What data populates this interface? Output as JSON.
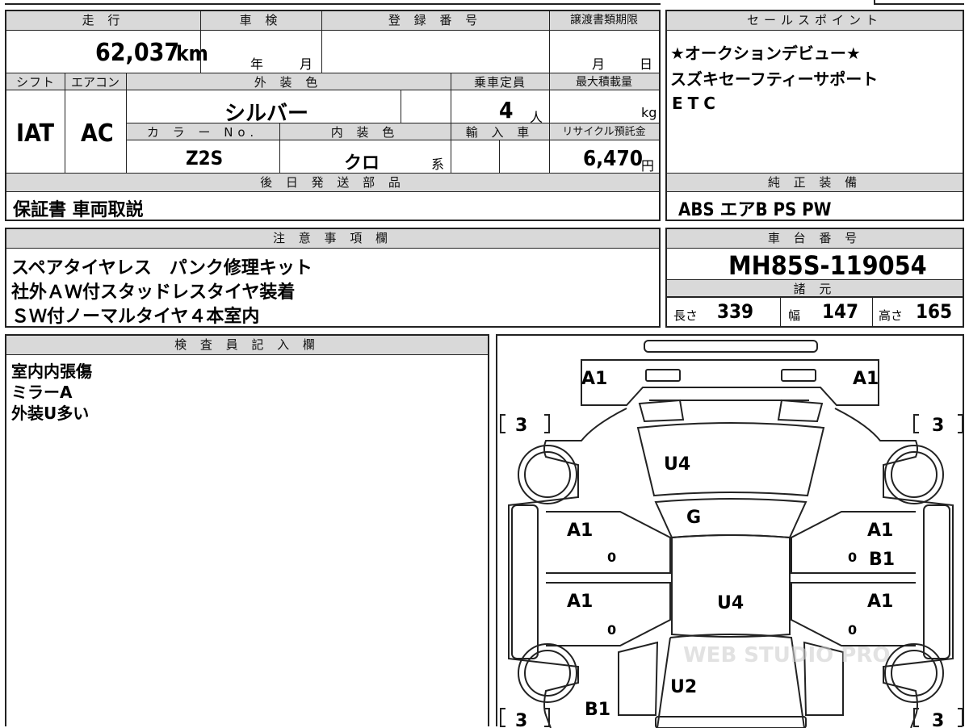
{
  "vehicle": {
    "mileage_label": "走 行",
    "mileage_value": "62,037",
    "mileage_unit": "km",
    "shaken_label": "車 検",
    "shaken_year_unit": "年",
    "shaken_month_unit": "月",
    "registration_label": "登 録 番 号",
    "transfer_label": "譲渡書類期限",
    "transfer_month_unit": "月",
    "transfer_day_unit": "日",
    "shift_label": "シフト",
    "shift_value": "IAT",
    "aircon_label": "エアコン",
    "aircon_value": "AC",
    "exterior_color_label": "外 装 色",
    "exterior_color_value": "シルバー",
    "capacity_label": "乗車定員",
    "capacity_value": "4",
    "capacity_unit": "人",
    "max_load_label": "最大積載量",
    "max_load_unit": "kg",
    "color_no_label": "カ ラ ー No.",
    "color_no_value": "Z2S",
    "interior_color_label": "内 装 色",
    "interior_color_value": "クロ",
    "interior_color_unit": "系",
    "import_label": "輸 入 車",
    "recycle_label": "リサイクル預託金",
    "recycle_value": "6,470",
    "recycle_unit": "円",
    "later_parts_label": "後 日 発 送 部 品",
    "later_parts_value": "保証書 車両取説"
  },
  "sales_points": {
    "label": "セールスポイント",
    "lines": [
      "★オークションデビュー★",
      "スズキセーフティーサポート",
      "ETC"
    ]
  },
  "genuine_equipment": {
    "label": "純 正 装 備",
    "value": "ABS エアB PS PW"
  },
  "notes": {
    "label": "注 意 事 項 欄",
    "lines": [
      "スペアタイヤレス　パンク修理キット",
      "社外ＡＷ付スタッドレスタイヤ装着",
      "ＳＷ付ノーマルタイヤ４本室内"
    ]
  },
  "chassis": {
    "label": "車 台 番 号",
    "value": "MH85S-119054",
    "specs_label": "諸 元",
    "length_label": "長さ",
    "length_value": "339",
    "width_label": "幅",
    "width_value": "147",
    "height_label": "高さ",
    "height_value": "165"
  },
  "inspector": {
    "label": "検 査 員 記 入 欄",
    "lines": [
      "室内内張傷",
      "ミラーA",
      "外装U多い"
    ]
  },
  "diagram": {
    "marks": {
      "front_left": "A1",
      "front_right": "A1",
      "hood": "U4",
      "windshield": "G",
      "front_door_left": "A1",
      "front_door_right_1": "A1",
      "front_door_right_2": "B1",
      "rear_door_left": "A1",
      "rear_door_right": "A1",
      "roof": "U4",
      "rear": "U2",
      "rear_left": "B1",
      "tire_fl": "3",
      "tire_fr": "3",
      "tire_rl": "3",
      "tire_rr": "3",
      "zero_a": "0",
      "zero_b": "0",
      "zero_c": "0",
      "zero_d": "0"
    },
    "watermark": "WEB STUDIO PRO"
  }
}
